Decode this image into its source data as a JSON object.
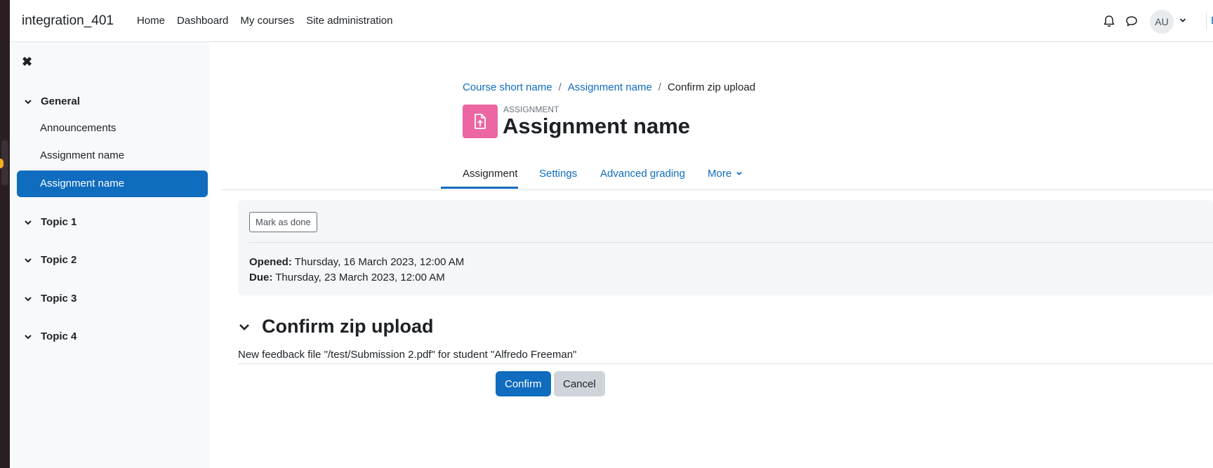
{
  "navbar": {
    "site_name": "integration_401",
    "links": [
      "Home",
      "Dashboard",
      "My courses",
      "Site administration"
    ],
    "icons": [
      "bell-icon",
      "chat-icon"
    ],
    "avatar_initials": "AU",
    "edge_link": "E"
  },
  "drawer": {
    "close_icon": "✖",
    "sections": [
      {
        "title": "General",
        "items": [
          "Announcements",
          "Assignment name",
          "Assignment name"
        ]
      },
      {
        "title": "Topic 1"
      },
      {
        "title": "Topic 2"
      },
      {
        "title": "Topic 3"
      },
      {
        "title": "Topic 4"
      }
    ],
    "active_item": "Assignment name"
  },
  "page": {
    "breadcrumb": [
      "Course short name",
      "Assignment name",
      "Confirm zip upload"
    ],
    "breadcrumb_separator": "/",
    "activity_kind": "ASSIGNMENT",
    "title": "Assignment name",
    "tabs": [
      "Assignment",
      "Settings",
      "Advanced grading",
      "More"
    ],
    "active_tab": "Assignment"
  },
  "activity_info": {
    "mark_done_label": "Mark as done",
    "opened_label": "Opened:",
    "opened_value": "Thursday, 16 March 2023, 12:00 AM",
    "due_label": "Due:",
    "due_value": "Thursday, 23 March 2023, 12:00 AM"
  },
  "confirm": {
    "heading": "Confirm zip upload",
    "message": "New feedback file \"/test/Submission 2.pdf\" for student \"Alfredo Freeman\"",
    "confirm_label": "Confirm",
    "cancel_label": "Cancel"
  },
  "colors": {
    "brand": "#0f6cbf",
    "assignment_icon_bg": "#eb66a2",
    "drawer_bg": "#f8f9fa"
  }
}
